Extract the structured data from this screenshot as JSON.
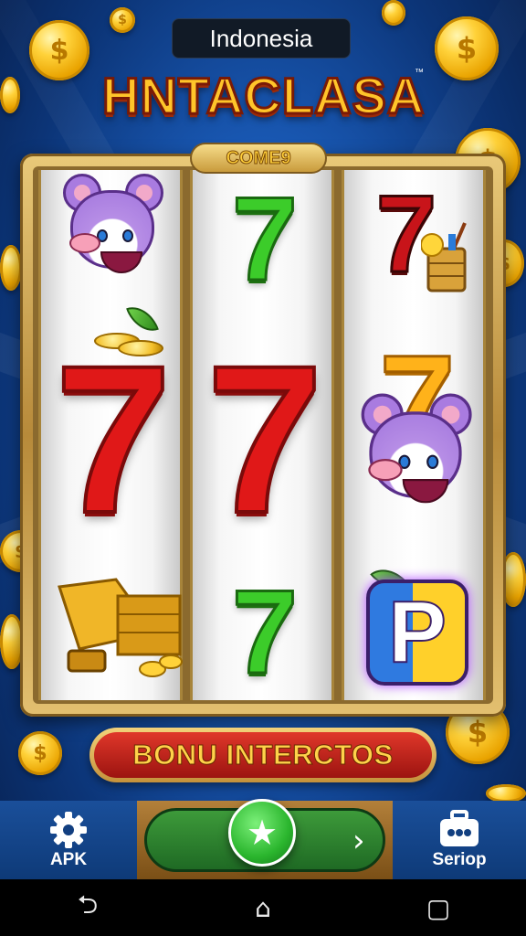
{
  "header": {
    "country": "Indonesia",
    "logo_text": "HNTACLASA",
    "trademark": "™"
  },
  "reels": {
    "badge_text": "COME9",
    "symbols": {
      "seven": "7",
      "letter": "P"
    },
    "icons": [
      "mouse-icon",
      "seven-icon",
      "gold-cart-icon",
      "drink-icon",
      "letter-p-icon"
    ]
  },
  "bonus": {
    "label": "BONU INTERCTOS"
  },
  "bottom_nav": {
    "apk_label": "APK",
    "serio_label": "Seriop",
    "play_icon": "★",
    "arrow_icon": "›"
  },
  "system_nav": {
    "back": "⮌",
    "home": "⌂",
    "recent": "▢"
  },
  "colors": {
    "background": "#1a5bb8",
    "frame_gold": "#c99b3c",
    "seven_red": "#e01818",
    "seven_green": "#3ccc2a",
    "seven_gold": "#ffb21a",
    "bonus_red": "#c9241c",
    "play_green": "#2bb62e"
  }
}
